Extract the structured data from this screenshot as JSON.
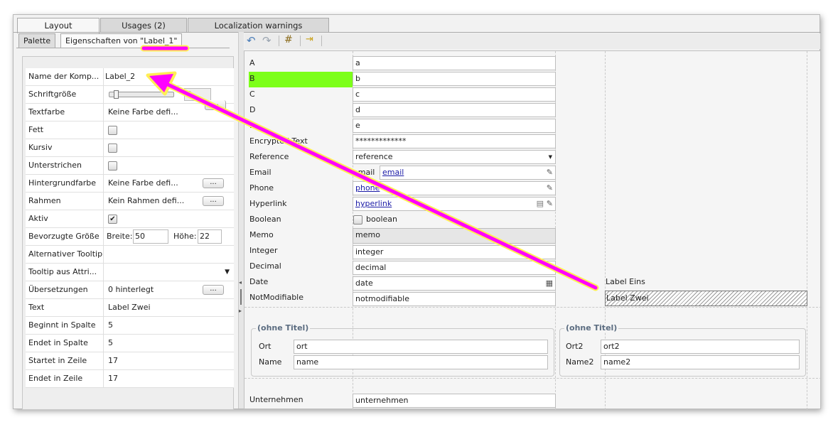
{
  "tabs": {
    "layout": "Layout",
    "usages": "Usages (2)",
    "loc": "Localization warnings"
  },
  "subtabs": {
    "palette": "Palette",
    "props": "Eigenschaften von \"Label_1\""
  },
  "props": [
    {
      "name": "Name der Komp...",
      "value": "Label_2"
    },
    {
      "name": "Schriftgröße",
      "value": "0"
    },
    {
      "name": "Textfarbe",
      "value": "Keine Farbe defi...",
      "btn": "..."
    },
    {
      "name": "Fett",
      "value": ""
    },
    {
      "name": "Kursiv",
      "value": ""
    },
    {
      "name": "Unterstrichen",
      "value": ""
    },
    {
      "name": "Hintergrundfarbe",
      "value": "Keine Farbe defi...",
      "btn": "..."
    },
    {
      "name": "Rahmen",
      "value": "Kein Rahmen defi...",
      "btn": "..."
    },
    {
      "name": "Aktiv",
      "value": "✔"
    },
    {
      "name": "Bevorzugte Größe",
      "breite_label": "Breite:",
      "breite": "50",
      "hoehe_label": "Höhe:",
      "hoehe": "22"
    },
    {
      "name": "Alternativer Tooltip",
      "value": ""
    },
    {
      "name": "Tooltip aus Attri...",
      "value": ""
    },
    {
      "name": "Übersetzungen",
      "value": "0 hinterlegt",
      "btn": "..."
    },
    {
      "name": "Text",
      "value": "Label Zwei"
    },
    {
      "name": "Beginnt in Spalte",
      "value": "5"
    },
    {
      "name": "Endet in Spalte",
      "value": "5"
    },
    {
      "name": "Startet in Zeile",
      "value": "17"
    },
    {
      "name": "Endet in Zeile",
      "value": "17"
    }
  ],
  "form": {
    "rows": [
      {
        "label": "A",
        "value": "a"
      },
      {
        "label": "B",
        "value": "b"
      },
      {
        "label": "C",
        "value": "c"
      },
      {
        "label": "D",
        "value": "d"
      },
      {
        "label": "E",
        "value": "e"
      },
      {
        "label": "Encrypted Text",
        "value": "*************"
      },
      {
        "label": "Reference",
        "value": "reference"
      },
      {
        "label": "Email",
        "prefix": "email",
        "value": "email"
      },
      {
        "label": "Phone",
        "value": "phone"
      },
      {
        "label": "Hyperlink",
        "value": "hyperlink"
      },
      {
        "label": "Boolean",
        "value": "boolean"
      },
      {
        "label": "Memo",
        "value": "memo"
      },
      {
        "label": "Integer",
        "value": "integer"
      },
      {
        "label": "Decimal",
        "value": "decimal"
      },
      {
        "label": "Date",
        "value": "date"
      },
      {
        "label": "NotModifiable",
        "value": "notmodifiable"
      }
    ],
    "label_eins": "Label Eins",
    "label_zwei": "Label Zwei",
    "group1": {
      "title": "(ohne Titel)",
      "rows": [
        {
          "label": "Ort",
          "value": "ort"
        },
        {
          "label": "Name",
          "value": "name"
        }
      ]
    },
    "group2": {
      "title": "(ohne Titel)",
      "rows": [
        {
          "label": "Ort2",
          "value": "ort2"
        },
        {
          "label": "Name2",
          "value": "name2"
        }
      ]
    },
    "unternehmen": {
      "label": "Unternehmen",
      "value": "unternehmen"
    }
  },
  "colors": {
    "highlight_b": "#7dff1a",
    "arrow": "#ff00ff",
    "arrow_outline": "#ffee55"
  }
}
